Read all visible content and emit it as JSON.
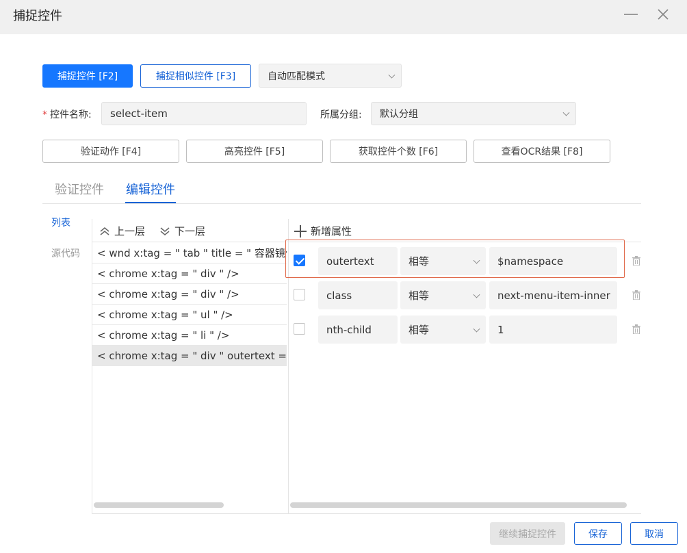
{
  "window": {
    "title": "捕捉控件"
  },
  "toolbar": {
    "capture_label": "捕捉控件 [F2]",
    "capture_similar_label": "捕捉相似控件 [F3]",
    "match_mode": "自动匹配模式"
  },
  "form": {
    "name_label": "控件名称:",
    "name_value": "select-item",
    "group_label": "所属分组:",
    "group_value": "默认分组"
  },
  "actions": {
    "verify": "验证动作 [F4]",
    "highlight": "高亮控件 [F5]",
    "count": "获取控件个数 [F6]",
    "ocr": "查看OCR结果 [F8]"
  },
  "tabs": {
    "verify": "验证控件",
    "edit": "编辑控件"
  },
  "side": {
    "list": "列表",
    "source": "源代码"
  },
  "tree": {
    "up": "上一层",
    "down": "下一层",
    "rows": [
      "< wnd  x:tag = \" tab \"  title = \" 容器镜像服务",
      "< chrome  x:tag = \" div \" />",
      "< chrome  x:tag = \" div \" />",
      "< chrome  x:tag = \" ul \" />",
      "< chrome  x:tag = \" li \" />",
      "< chrome  x:tag = \" div \"  outertext = \" $namespace"
    ]
  },
  "props": {
    "add_label": "新增属性",
    "rows": [
      {
        "checked": true,
        "name": "outertext",
        "op": "相等",
        "value": "$namespace"
      },
      {
        "checked": false,
        "name": "class",
        "op": "相等",
        "value": "next-menu-item-inner"
      },
      {
        "checked": false,
        "name": "nth-child",
        "op": "相等",
        "value": "1"
      }
    ]
  },
  "footer": {
    "continue": "继续捕捉控件",
    "save": "保存",
    "cancel": "取消"
  },
  "colors": {
    "accent": "#1677ff",
    "link": "#1763d6",
    "highlight": "#e0694a"
  }
}
